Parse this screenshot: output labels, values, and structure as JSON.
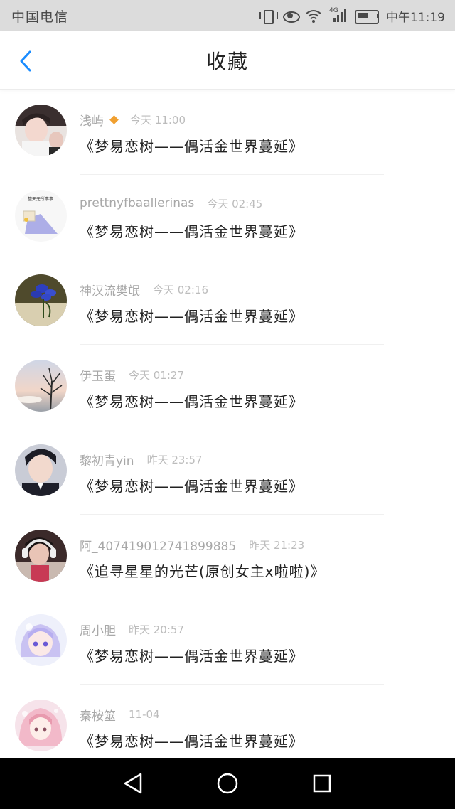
{
  "status_bar": {
    "carrier": "中国电信",
    "network": "4G",
    "time": "中午11:19"
  },
  "header": {
    "title": "收藏",
    "back_icon": "chevron-left-icon",
    "accent_color": "#1a8cff"
  },
  "items": [
    {
      "author": "浅屿",
      "vip": true,
      "time": "今天 11:00",
      "title": "《梦易恋树——偶活金世界蔓延》",
      "avatar": "boy-portrait"
    },
    {
      "author": "prettnyfbaallerinas",
      "vip": false,
      "time": "今天 02:45",
      "title": "《梦易恋树——偶活金世界蔓延》",
      "avatar": "meme-sign",
      "avatar_text": "整天无所事事"
    },
    {
      "author": "神汉流樊氓",
      "vip": false,
      "time": "今天 02:16",
      "title": "《梦易恋树——偶活金世界蔓延》",
      "avatar": "blue-flower"
    },
    {
      "author": "伊玉蛋",
      "vip": false,
      "time": "今天 01:27",
      "title": "《梦易恋树——偶活金世界蔓延》",
      "avatar": "tree-sunset"
    },
    {
      "author": "黎初青yin",
      "vip": false,
      "time": "昨天 23:57",
      "title": "《梦易恋树——偶活金世界蔓延》",
      "avatar": "boy-suit"
    },
    {
      "author": "阿_407419012741899885",
      "vip": false,
      "time": "昨天 21:23",
      "title": "《追寻星星的光芒(原创女主x啦啦)》",
      "avatar": "girl-headphones"
    },
    {
      "author": "周小胆",
      "vip": false,
      "time": "昨天 20:57",
      "title": "《梦易恋树——偶活金世界蔓延》",
      "avatar": "anime-girl-purple"
    },
    {
      "author": "秦桉筮",
      "vip": false,
      "time": "11-04",
      "title": "《梦易恋树——偶活金世界蔓延》",
      "avatar": "anime-girl-pink"
    }
  ],
  "nav": {
    "back": "triangle-back-icon",
    "home": "circle-home-icon",
    "recent": "square-recent-icon"
  }
}
